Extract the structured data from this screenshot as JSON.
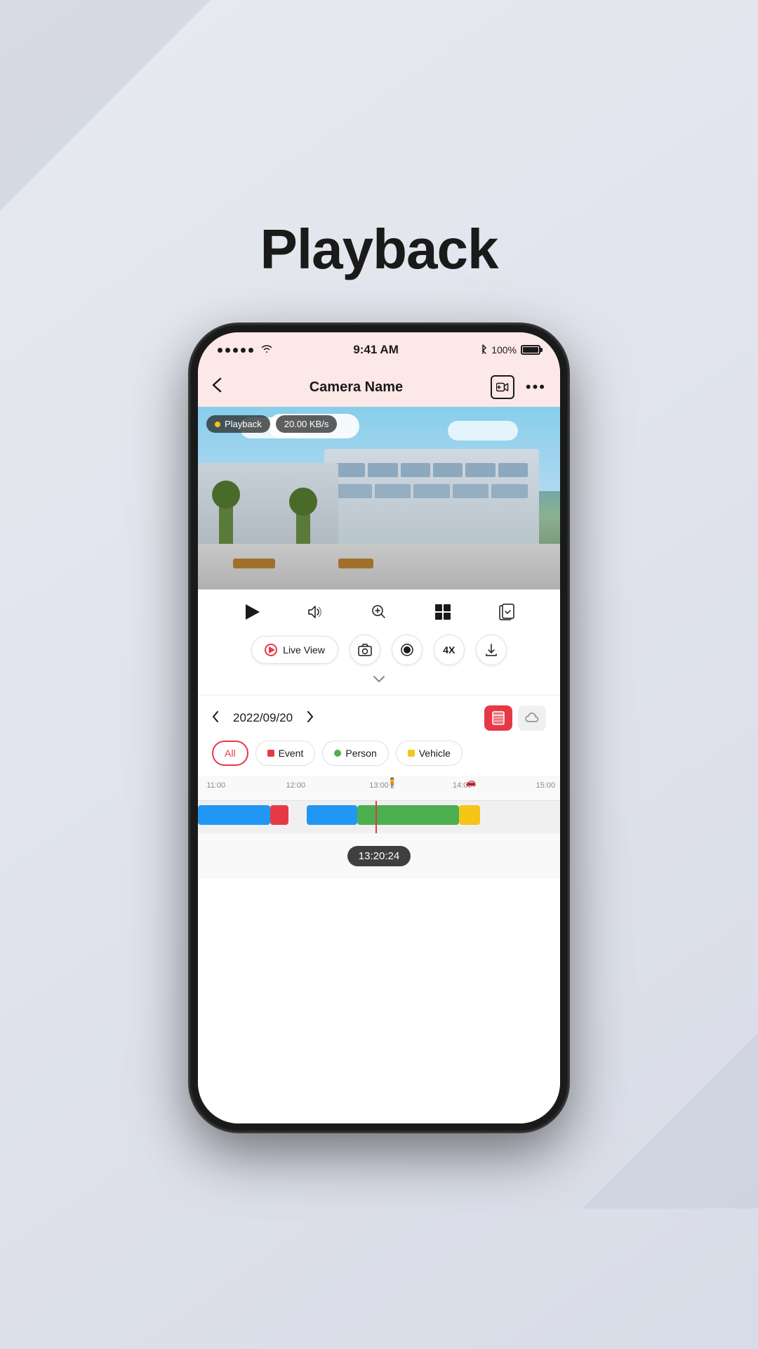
{
  "page": {
    "title": "Playback",
    "background_color": "#e2e5ef"
  },
  "status_bar": {
    "dots": 5,
    "wifi": "wifi",
    "time": "9:41 AM",
    "bluetooth": "bluetooth",
    "battery_pct": "100%",
    "bg_color": "#fce8e6"
  },
  "nav": {
    "back_icon": "back-arrow",
    "title": "Camera Name",
    "add_video_icon": "add-video-icon",
    "more_icon": "more-options-icon",
    "bg_color": "#fce8e6"
  },
  "video": {
    "badge_playback": "Playback",
    "badge_speed": "20.00 KB/s"
  },
  "controls": {
    "play_icon": "play-icon",
    "volume_icon": "volume-icon",
    "zoom_icon": "zoom-in-icon",
    "grid_icon": "grid-icon",
    "screenshot_icon": "screenshot-icon",
    "live_view_label": "Live View",
    "camera_icon": "camera-icon",
    "record_icon": "record-icon",
    "speed_label": "4X",
    "download_icon": "download-icon",
    "chevron": "chevron-down-icon"
  },
  "date_nav": {
    "left_arrow": "left-arrow",
    "date": "2022/09/20",
    "right_arrow": "right-arrow",
    "storage_sd_icon": "sd-storage-icon",
    "storage_cloud_icon": "cloud-storage-icon"
  },
  "filters": {
    "all": "All",
    "event": "Event",
    "person": "Person",
    "vehicle": "Vehicle"
  },
  "timeline": {
    "labels": [
      "11:00",
      "12:00",
      "13:00",
      "14:00",
      "15:00"
    ],
    "current_time": "13:20:24",
    "segments": [
      {
        "type": "blue",
        "start_pct": 0,
        "width_pct": 20
      },
      {
        "type": "red",
        "start_pct": 20,
        "width_pct": 5
      },
      {
        "type": "blue",
        "start_pct": 30,
        "width_pct": 14
      },
      {
        "type": "green",
        "start_pct": 44,
        "width_pct": 28
      },
      {
        "type": "yellow",
        "start_pct": 72,
        "width_pct": 6
      }
    ],
    "playhead_pct": 49
  }
}
